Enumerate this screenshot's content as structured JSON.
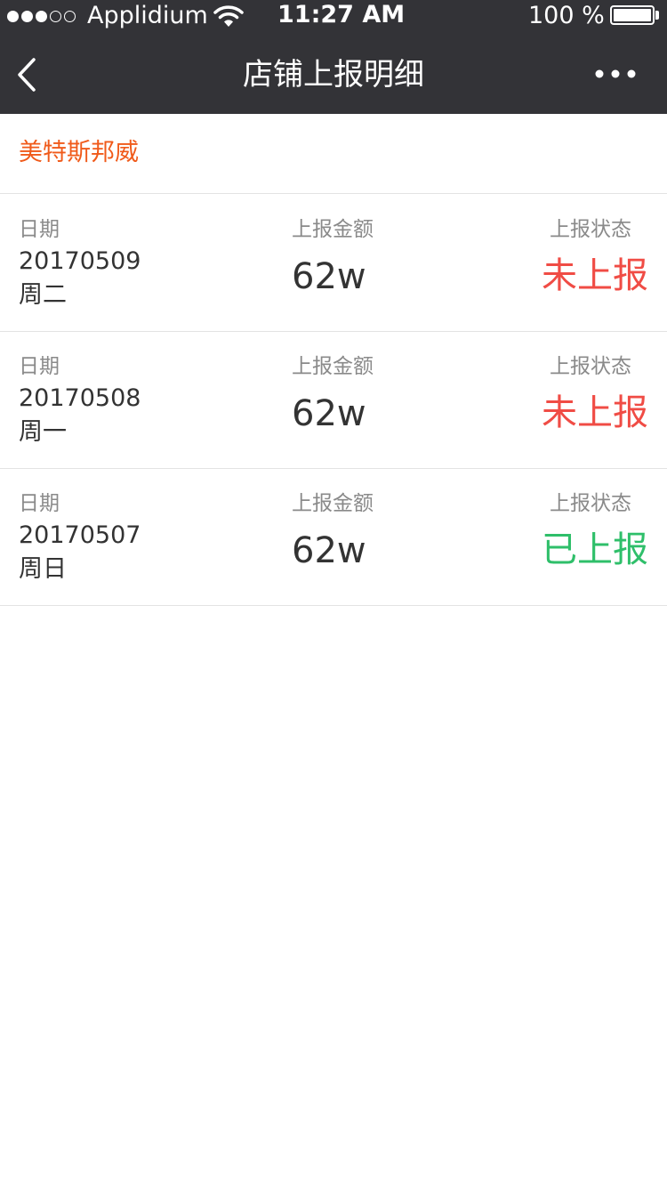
{
  "status_bar": {
    "carrier": "Applidium",
    "time": "11:27 AM",
    "battery": "100 %",
    "signal_bars_filled": 3,
    "signal_bars_total": 5
  },
  "nav": {
    "title": "店铺上报明细",
    "back_icon": "chevron-left-icon",
    "more_icon": "more-dots-icon"
  },
  "store": {
    "name": "美特斯邦威"
  },
  "labels": {
    "date": "日期",
    "amount": "上报金额",
    "status": "上报状态"
  },
  "colors": {
    "nav_bg": "#333337",
    "store_name": "#f05a1a",
    "not_reported": "#f04c45",
    "reported": "#2fbf6a",
    "label": "#8a8a8a",
    "value": "#333333",
    "divider": "#e3e3e3"
  },
  "records": [
    {
      "date": "20170509",
      "weekday": "周二",
      "amount": "62w",
      "status": "未上报",
      "status_type": "not_reported"
    },
    {
      "date": "20170508",
      "weekday": "周一",
      "amount": "62w",
      "status": "未上报",
      "status_type": "not_reported"
    },
    {
      "date": "20170507",
      "weekday": "周日",
      "amount": "62w",
      "status": "已上报",
      "status_type": "reported"
    }
  ]
}
